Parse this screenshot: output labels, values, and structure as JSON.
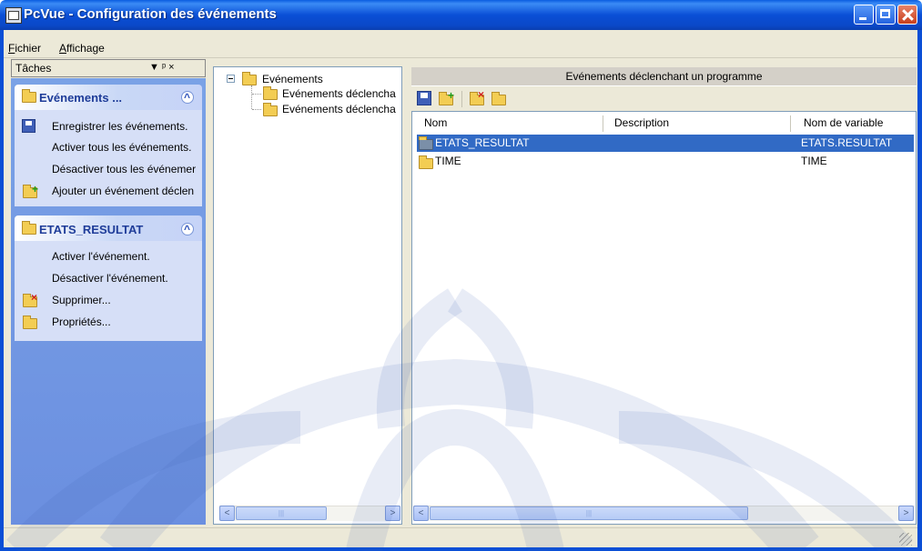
{
  "window": {
    "title": "PcVue - Configuration des événements"
  },
  "menu": [
    {
      "label": "Fichier",
      "underline": "F",
      "rest": "ichier"
    },
    {
      "label": "Affichage",
      "underline": "A",
      "rest": "ffichage"
    }
  ],
  "tasks_pane": {
    "title": "Tâches",
    "controls": "▼  ᵖ  ×",
    "groups": [
      {
        "title": "Evénements ...",
        "items": [
          {
            "label": "Enregistrer les événements.",
            "icon": "save-icon"
          },
          {
            "label": "Activer tous les événements.",
            "icon": ""
          },
          {
            "label": "Désactiver tous les événemer",
            "icon": ""
          },
          {
            "label": "Ajouter un événement déclen",
            "icon": "add-folder-icon"
          }
        ]
      },
      {
        "title": "ETATS_RESULTAT",
        "items": [
          {
            "label": "Activer l'événement.",
            "icon": ""
          },
          {
            "label": "Désactiver l'événement.",
            "icon": ""
          },
          {
            "label": "Supprimer...",
            "icon": "delete-folder-icon"
          },
          {
            "label": "Propriétés...",
            "icon": "properties-icon"
          }
        ]
      }
    ]
  },
  "tree": {
    "root": {
      "label": "Evénements",
      "expander": "⊟"
    },
    "children": [
      {
        "label": "Evénements déclencha"
      },
      {
        "label": "Evénements déclencha"
      }
    ]
  },
  "list": {
    "header": "Evénements déclenchant un programme",
    "toolbar": [
      "save-icon",
      "add-folder-icon",
      "delete-folder-icon",
      "properties-icon"
    ],
    "columns": [
      "Nom",
      "Description",
      "Nom de variable"
    ],
    "rows": [
      {
        "name": "ETATS_RESULTAT",
        "description": "",
        "variable": "ETATS.RESULTAT",
        "selected": true
      },
      {
        "name": "TIME",
        "description": "",
        "variable": "TIME",
        "selected": false
      }
    ]
  },
  "scrollbars": {
    "left_arrow": "<",
    "right_arrow": ">",
    "thumb_grip": "|||"
  },
  "colors": {
    "titlebar": "#0a4fd6",
    "task_pane_bg": "#6b8fe0",
    "task_group_body": "#d6dff7",
    "selection": "#316ac5"
  }
}
